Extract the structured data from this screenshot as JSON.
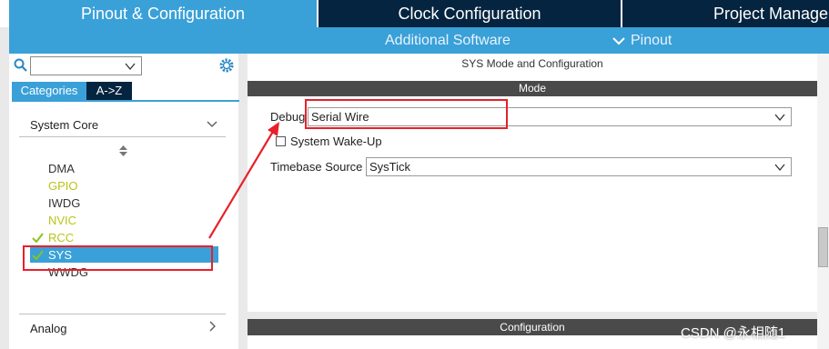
{
  "tabs": {
    "pinout": "Pinout & Configuration",
    "clock": "Clock Configuration",
    "project": "Project Manage"
  },
  "subbar": {
    "software": "Additional Software",
    "pinout": "Pinout"
  },
  "sidebar": {
    "search_value": "",
    "categories_tab": "Categories",
    "az_tab": "A->Z",
    "section_system_core": "System Core",
    "section_analog": "Analog",
    "items": [
      {
        "label": "DMA",
        "status": "none"
      },
      {
        "label": "GPIO",
        "status": "warning"
      },
      {
        "label": "IWDG",
        "status": "none"
      },
      {
        "label": "NVIC",
        "status": "warning"
      },
      {
        "label": "RCC",
        "status": "checked"
      },
      {
        "label": "SYS",
        "status": "checked-selected"
      },
      {
        "label": "WWDG",
        "status": "none"
      }
    ]
  },
  "main": {
    "title": "SYS Mode and Configuration",
    "mode_header": "Mode",
    "debug_label": "Debug",
    "debug_value": "Serial Wire",
    "wakeup_label": "System Wake-Up",
    "wakeup_checked": false,
    "timebase_label": "Timebase Source",
    "timebase_value": "SysTick",
    "config_header": "Configuration"
  },
  "watermark": "CSDN @永相随1",
  "colors": {
    "accent": "#3aa0d8",
    "dark_tab": "#05243f",
    "section_header": "#4a4a4a",
    "warning_text": "#b9c41a",
    "check_green": "#8dc021",
    "annotation_red": "#e8202a"
  }
}
